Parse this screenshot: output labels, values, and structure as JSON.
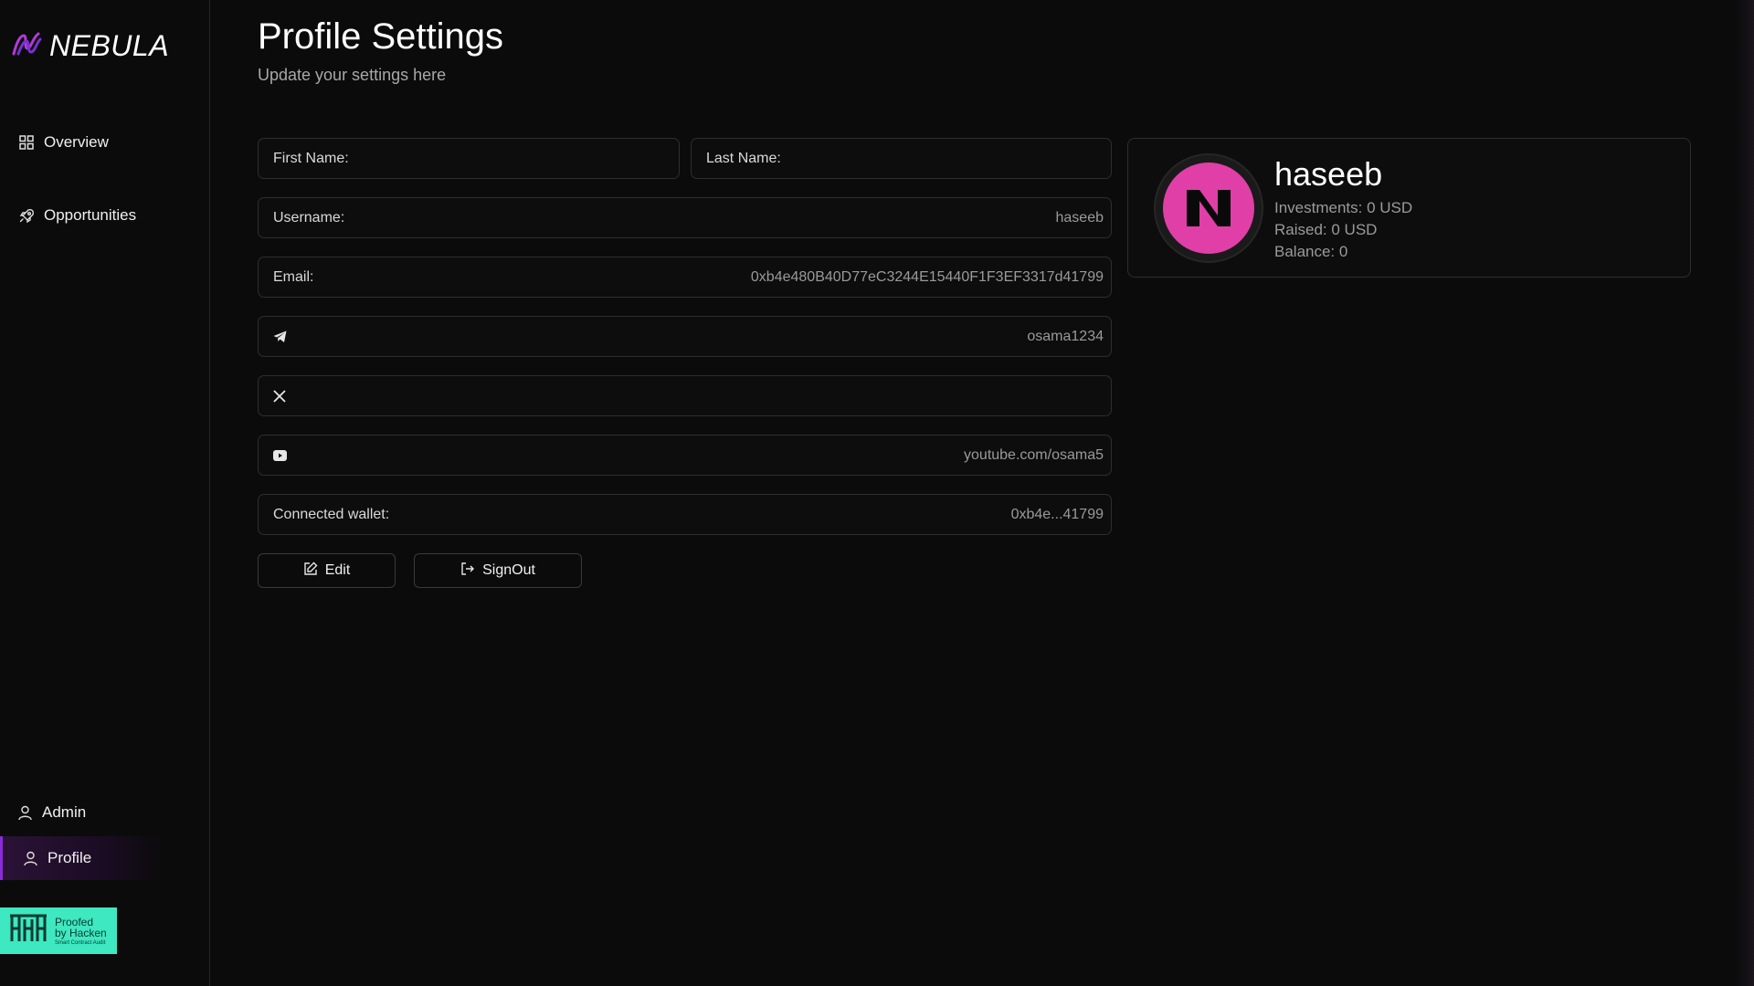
{
  "brand": {
    "name": "NEBULA",
    "logo_icon": "nebula-logo-icon",
    "accent": "#8b2bd6"
  },
  "sidebar": {
    "items": [
      {
        "label": "Overview",
        "icon": "grid-icon"
      },
      {
        "label": "Opportunities",
        "icon": "rocket-icon"
      }
    ],
    "bottom_items": [
      {
        "label": "Admin",
        "icon": "user-icon"
      },
      {
        "label": "Profile",
        "icon": "user-icon",
        "active": true
      }
    ],
    "badge": {
      "line1": "Proofed",
      "line2": "by Hacken",
      "line3": "Smart Contract Audit",
      "color": "#3ee8c1"
    }
  },
  "page": {
    "title": "Profile Settings",
    "subtitle": "Update your settings here"
  },
  "form": {
    "first_name_label": "First Name:",
    "last_name_label": "Last Name:",
    "username_label": "Username:",
    "username_value": "haseeb",
    "email_label": "Email:",
    "email_value": "0xb4e480B40D77eC3244E15440F1F3EF3317d41799",
    "telegram_value": "osama1234",
    "x_value": "",
    "youtube_value": "youtube.com/osama5",
    "wallet_label": "Connected wallet:",
    "wallet_value": "0xb4e...41799"
  },
  "actions": {
    "edit_label": "Edit",
    "signout_label": "SignOut"
  },
  "profile_card": {
    "name": "haseeb",
    "investments": "Investments: 0 USD",
    "raised": "Raised: 0 USD",
    "balance": "Balance: 0",
    "avatar_color": "#e03fa8"
  }
}
